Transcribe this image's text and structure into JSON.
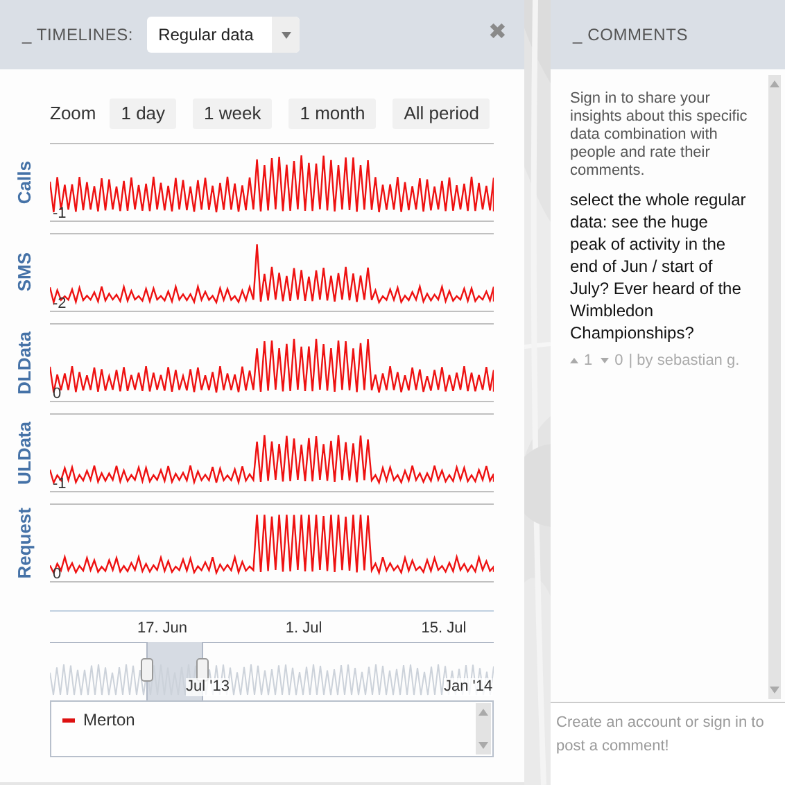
{
  "timelines": {
    "title": "_ TIMELINES:",
    "dataset": "Regular data",
    "close": "✖"
  },
  "zoom": {
    "label": "Zoom",
    "options": [
      {
        "label": "1 day",
        "selected": false
      },
      {
        "label": "1 week",
        "selected": false
      },
      {
        "label": "1 month",
        "selected": false
      },
      {
        "label": "All period",
        "selected": false
      }
    ]
  },
  "series": [
    {
      "name": "Calls",
      "min_label": "-1"
    },
    {
      "name": "SMS",
      "min_label": "-2"
    },
    {
      "name": "DLData",
      "min_label": "0"
    },
    {
      "name": "ULData",
      "min_label": "-1"
    },
    {
      "name": "Request",
      "min_label": "0"
    }
  ],
  "x_axis": [
    "17. Jun",
    "1. Jul",
    "15. Jul"
  ],
  "navigator": {
    "labels": [
      "Jul '13",
      "Jan '14"
    ]
  },
  "legend": [
    {
      "name": "Merton",
      "color": "#dd1111"
    }
  ],
  "comments": {
    "title": "_ COMMENTS",
    "intro": "Sign in to share your insights about this specific data combination with people and rate their comments.",
    "items": [
      {
        "text": "select the whole regular data: see the huge peak of activity in the end of Jun / start of July? Ever heard of the Wimbledon Championships?",
        "up": "1",
        "down": "0",
        "author": "| by sebastian g."
      }
    ],
    "placeholder": "Create an account or sign in to post a comment!"
  }
}
